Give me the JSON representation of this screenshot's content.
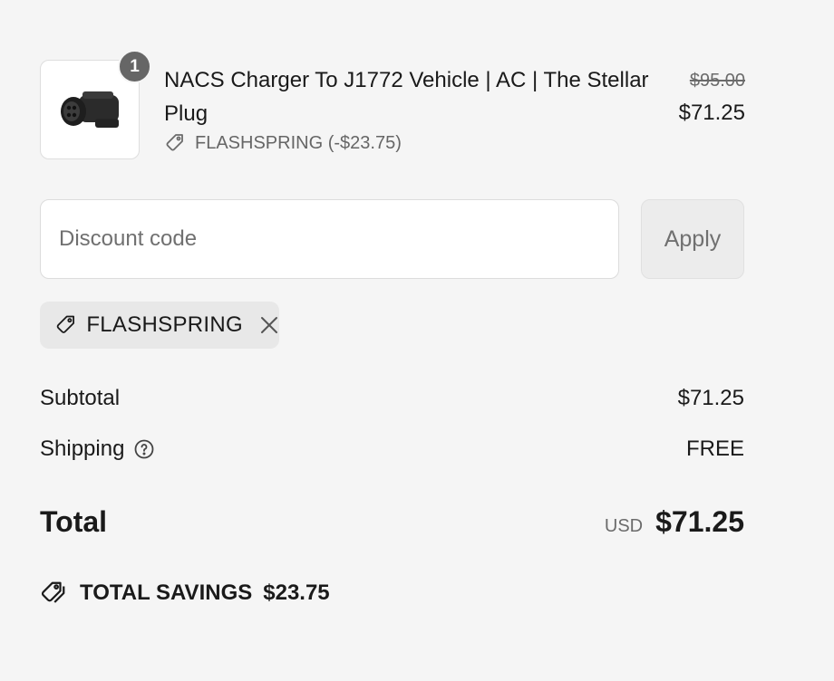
{
  "cart": {
    "item": {
      "quantity": "1",
      "title": "NACS Charger To J1772 Vehicle | AC | The Stellar Plug",
      "discount_label": "FLASHSPRING (-$23.75)",
      "original_price": "$95.00",
      "price": "$71.25",
      "image_icon": "ev-adapter-plug-image"
    }
  },
  "discount": {
    "placeholder": "Discount code",
    "value": "",
    "apply_label": "Apply",
    "applied_code": "FLASHSPRING"
  },
  "summary": {
    "subtotal_label": "Subtotal",
    "subtotal_value": "$71.25",
    "shipping_label": "Shipping",
    "shipping_value": "FREE",
    "total_label": "Total",
    "currency": "USD",
    "total_value": "$71.25",
    "savings_label": "TOTAL SAVINGS",
    "savings_value": "$23.75"
  },
  "colors": {
    "background": "#f5f5f5",
    "text": "#1a1a1a",
    "muted": "#6b6b6b",
    "badge": "#666666"
  }
}
